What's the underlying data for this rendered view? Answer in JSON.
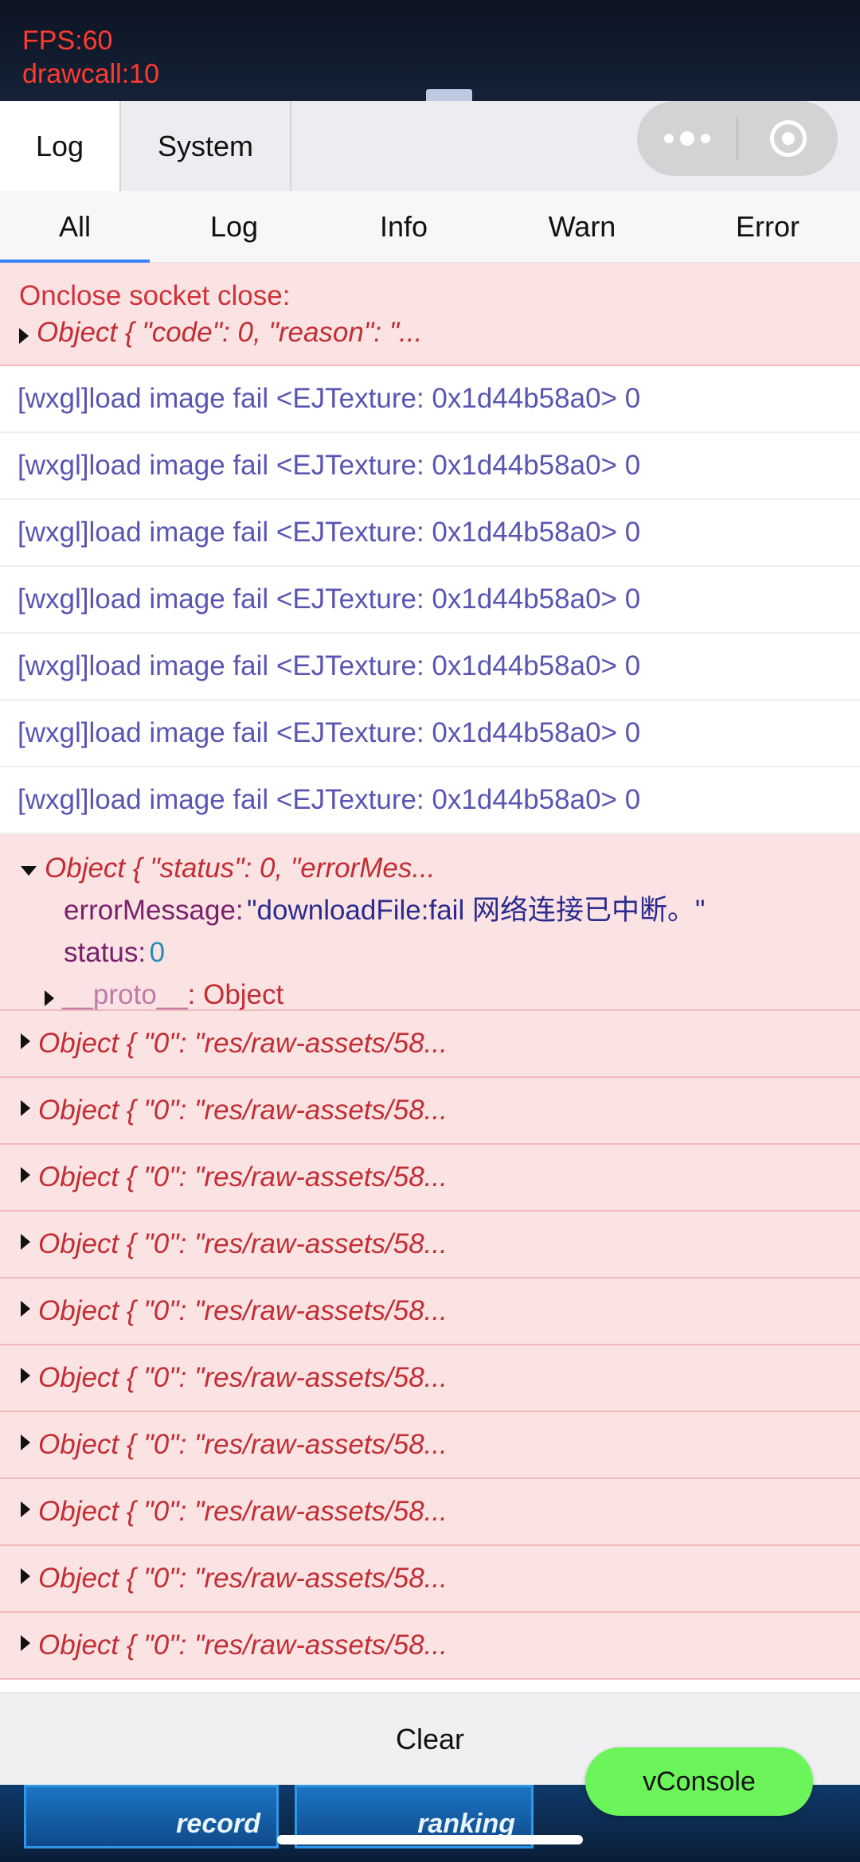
{
  "game_overlay": {
    "fps": "FPS:60",
    "drawcall": "drawcall:10",
    "bottom_buttons": [
      "record",
      "ranking"
    ]
  },
  "top_tabs": [
    {
      "label": "Log",
      "active": true
    },
    {
      "label": "System",
      "active": false
    }
  ],
  "capsule": {
    "menu_icon": "more-dots-icon",
    "close_icon": "target-circle-icon"
  },
  "filter_tabs": [
    {
      "label": "All",
      "active": true
    },
    {
      "label": "Log",
      "active": false
    },
    {
      "label": "Info",
      "active": false
    },
    {
      "label": "Warn",
      "active": false
    },
    {
      "label": "Error",
      "active": false
    }
  ],
  "entries": {
    "socket_close": {
      "message": "Onclose socket close:",
      "object": "Object { \"code\": 0, \"reason\": \"..."
    },
    "image_fail": [
      "[wxgl]load image fail <EJTexture: 0x1d44b58a0> 0",
      "[wxgl]load image fail <EJTexture: 0x1d44b58a0> 0",
      "[wxgl]load image fail <EJTexture: 0x1d44b58a0> 0",
      "[wxgl]load image fail <EJTexture: 0x1d44b58a0> 0",
      "[wxgl]load image fail <EJTexture: 0x1d44b58a0> 0",
      "[wxgl]load image fail <EJTexture: 0x1d44b58a0> 0",
      "[wxgl]load image fail <EJTexture: 0x1d44b58a0> 0"
    ],
    "status_object": {
      "summary": "Object { \"status\": 0, \"errorMes...",
      "error_key": "errorMessage:",
      "error_value": "\"downloadFile:fail 网络连接已中断。\"",
      "status_key": "status:",
      "status_value": "0",
      "proto_key": "__proto__",
      "proto_value": ": Object"
    },
    "raw_assets": [
      "Object { \"0\": \"res/raw-assets/58...",
      "Object { \"0\": \"res/raw-assets/58...",
      "Object { \"0\": \"res/raw-assets/58...",
      "Object { \"0\": \"res/raw-assets/58...",
      "Object { \"0\": \"res/raw-assets/58...",
      "Object { \"0\": \"res/raw-assets/58...",
      "Object { \"0\": \"res/raw-assets/58...",
      "Object { \"0\": \"res/raw-assets/58...",
      "Object { \"0\": \"res/raw-assets/58...",
      "Object { \"0\": \"res/raw-assets/58..."
    ]
  },
  "footer": {
    "clear_label": "Clear"
  },
  "vconsole_label": "vConsole"
}
